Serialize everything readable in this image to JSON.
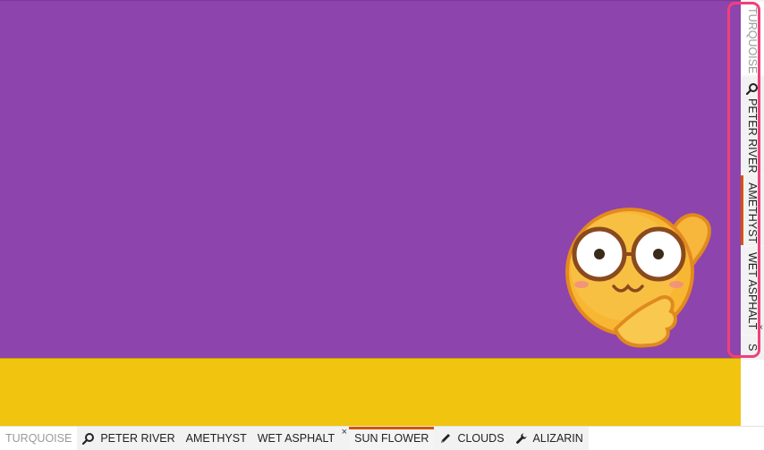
{
  "bottom_tabs": [
    {
      "label": "TURQUOISE",
      "state": "disabled",
      "icon": null,
      "closable": false
    },
    {
      "label": "PETER RIVER",
      "state": "normal",
      "icon": "search-icon",
      "closable": false
    },
    {
      "label": "AMETHYST",
      "state": "normal",
      "icon": null,
      "closable": false
    },
    {
      "label": "WET ASPHALT",
      "state": "normal",
      "icon": null,
      "closable": true
    },
    {
      "label": "SUN FLOWER",
      "state": "selected",
      "icon": null,
      "closable": false
    },
    {
      "label": "CLOUDS",
      "state": "normal",
      "icon": "pencil-icon",
      "closable": false
    },
    {
      "label": "ALIZARIN",
      "state": "normal",
      "icon": "wrench-icon",
      "closable": false
    }
  ],
  "right_tabs": [
    {
      "label": "TURQUOISE",
      "state": "disabled",
      "icon": null,
      "closable": false
    },
    {
      "label": "PETER RIVER",
      "state": "normal",
      "icon": "search-icon",
      "closable": false
    },
    {
      "label": "AMETHYST",
      "state": "selected",
      "icon": null,
      "closable": false
    },
    {
      "label": "WET ASPHALT",
      "state": "normal",
      "icon": null,
      "closable": true
    },
    {
      "label": "S",
      "state": "normal",
      "icon": null,
      "closable": false
    }
  ],
  "close_glyph": "×",
  "colors": {
    "amethyst": "#8e44ad",
    "sun_flower": "#f1c40f",
    "selected_indicator": "#d35400",
    "highlight_outline": "#f0407a"
  },
  "sticker": "emoji-sticker-waving"
}
